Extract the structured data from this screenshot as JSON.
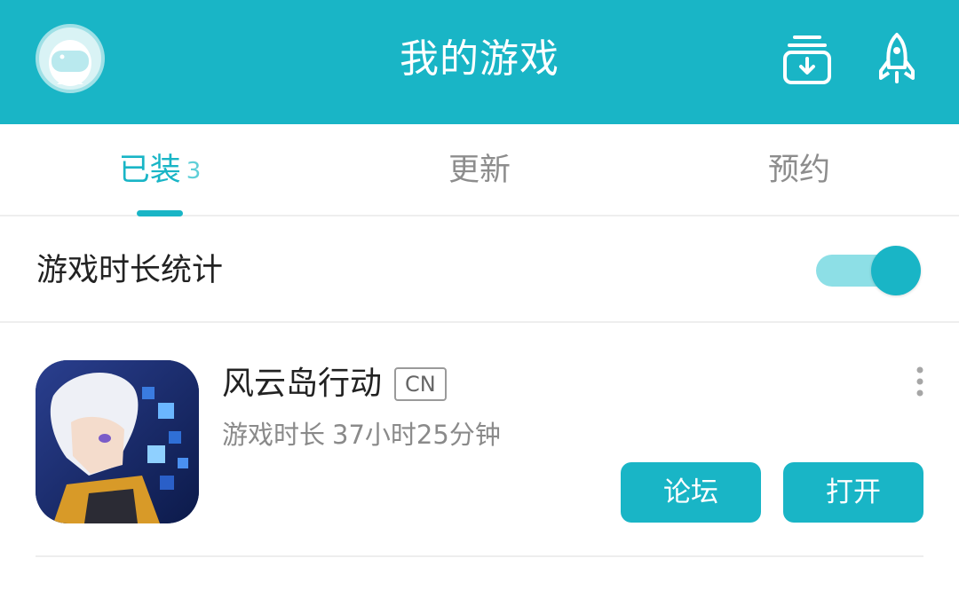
{
  "header": {
    "title": "我的游戏",
    "icons": [
      "astronaut-avatar",
      "download-icon",
      "rocket-icon"
    ]
  },
  "tabs": [
    {
      "label": "已装",
      "count": "3",
      "active": true
    },
    {
      "label": "更新",
      "active": false
    },
    {
      "label": "预约",
      "active": false
    }
  ],
  "stats": {
    "label": "游戏时长统计",
    "toggle_on": true
  },
  "game": {
    "name": "风云岛行动",
    "region": "CN",
    "playtime_label": "游戏时长",
    "playtime_value": "37小时25分钟",
    "forum_button": "论坛",
    "open_button": "打开"
  },
  "colors": {
    "accent": "#19b5c6",
    "toggle_track": "#8ddfe6"
  }
}
